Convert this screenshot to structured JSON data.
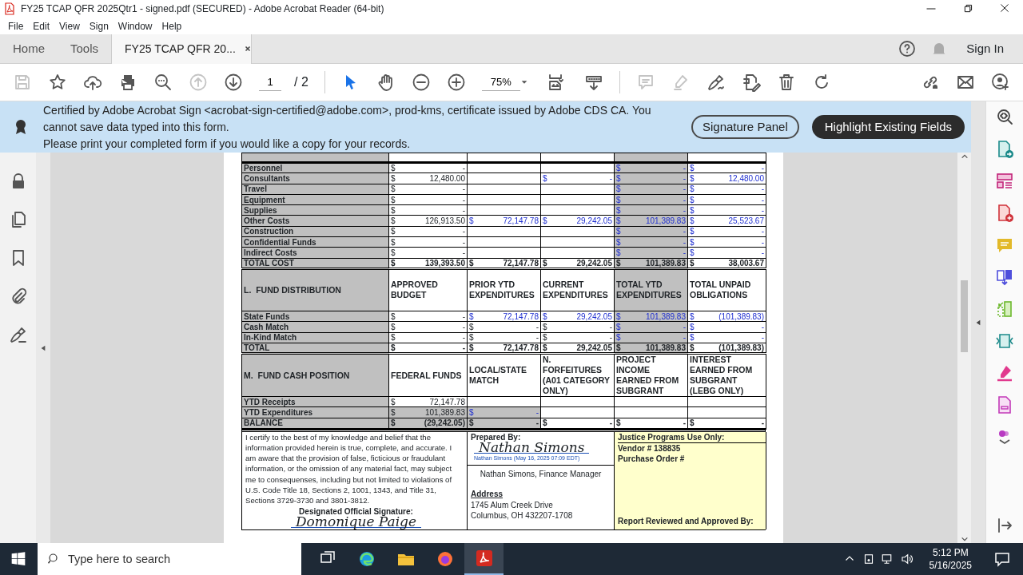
{
  "window": {
    "title": "FY25 TCAP QFR 2025Qtr1 - signed.pdf (SECURED) - Adobe Acrobat Reader (64-bit)"
  },
  "menu": [
    "File",
    "Edit",
    "View",
    "Sign",
    "Window",
    "Help"
  ],
  "tabs": [
    {
      "label": "Home",
      "selected": false
    },
    {
      "label": "Tools",
      "selected": false
    },
    {
      "label": "FY25 TCAP QFR 20...",
      "selected": true
    }
  ],
  "account": {
    "label": "Sign In"
  },
  "toolbar": {
    "tools": [
      {
        "disabled": true
      },
      {
        "disabled": false
      },
      {
        "disabled": false
      },
      {
        "disabled": false
      },
      {
        "disabled": false
      },
      {
        "disabled": true
      },
      {
        "disabled": false
      }
    ],
    "page": "1",
    "page_total": "/ 2",
    "tools_2": [
      {
        "selected": true
      },
      {
        "selected": false
      },
      {
        "selected": false
      },
      {
        "selected": false
      }
    ],
    "zoom": "75%",
    "tools_3": [
      {
        "disabled": true
      },
      {
        "disabled": true
      },
      {
        "disabled": false
      },
      {
        "disabled": false
      },
      {
        "disabled": false
      },
      {
        "disabled": false
      }
    ]
  },
  "banner": {
    "lines": [
      "Certified by Adobe Acrobat Sign <acrobat-sign-certified@adobe.com>, prod-kms, certificate issued by Adobe CDS CA.  You cannot save data typed into this form.",
      "Please print your completed form if you would like a copy for your records."
    ],
    "buttons": [
      {
        "label": "Signature Panel",
        "kind": "outline"
      },
      {
        "label": "Highlight Existing Fields",
        "kind": "dark"
      }
    ]
  },
  "document": {
    "table": {
      "rows": [
        {
          "kind": "line",
          "label": "Personnel",
          "bold": false,
          "cells": [
            {
              "kind": "amount",
              "sign": "$",
              "value": "-",
              "blue": false,
              "shaded": false
            },
            {
              "kind": "blank"
            },
            {
              "kind": "blank"
            },
            {
              "kind": "amount",
              "sign": "$",
              "value": "-",
              "blue": true,
              "shaded": true
            },
            {
              "kind": "amount",
              "sign": "$",
              "value": "-",
              "blue": true,
              "shaded": false
            }
          ]
        },
        {
          "kind": "line",
          "label": "Consultants",
          "bold": false,
          "cells": [
            {
              "kind": "amount",
              "sign": "$",
              "value": "12,480.00",
              "blue": false,
              "shaded": false
            },
            {
              "kind": "blank"
            },
            {
              "kind": "amount",
              "sign": "$",
              "value": "-",
              "blue": true,
              "shaded": false
            },
            {
              "kind": "amount",
              "sign": "$",
              "value": "-",
              "blue": true,
              "shaded": true
            },
            {
              "kind": "amount",
              "sign": "$",
              "value": "12,480.00",
              "blue": true,
              "shaded": false
            }
          ]
        },
        {
          "kind": "line",
          "label": "Travel",
          "bold": false,
          "cells": [
            {
              "kind": "amount",
              "sign": "$",
              "value": "-",
              "blue": false,
              "shaded": false
            },
            {
              "kind": "blank"
            },
            {
              "kind": "blank"
            },
            {
              "kind": "amount",
              "sign": "$",
              "value": "-",
              "blue": true,
              "shaded": true
            },
            {
              "kind": "amount",
              "sign": "$",
              "value": "-",
              "blue": true,
              "shaded": false
            }
          ]
        },
        {
          "kind": "line",
          "label": "Equipment",
          "bold": false,
          "cells": [
            {
              "kind": "amount",
              "sign": "$",
              "value": "-",
              "blue": false,
              "shaded": false
            },
            {
              "kind": "blank"
            },
            {
              "kind": "blank"
            },
            {
              "kind": "amount",
              "sign": "$",
              "value": "-",
              "blue": true,
              "shaded": true
            },
            {
              "kind": "amount",
              "sign": "$",
              "value": "-",
              "blue": true,
              "shaded": false
            }
          ]
        },
        {
          "kind": "line",
          "label": "Supplies",
          "bold": false,
          "cells": [
            {
              "kind": "amount",
              "sign": "$",
              "value": "-",
              "blue": false,
              "shaded": false
            },
            {
              "kind": "blank"
            },
            {
              "kind": "blank"
            },
            {
              "kind": "amount",
              "sign": "$",
              "value": "-",
              "blue": true,
              "shaded": true
            },
            {
              "kind": "amount",
              "sign": "$",
              "value": "-",
              "blue": true,
              "shaded": false
            }
          ]
        },
        {
          "kind": "line",
          "label": "Other Costs",
          "bold": false,
          "cells": [
            {
              "kind": "amount",
              "sign": "$",
              "value": "126,913.50",
              "blue": false,
              "shaded": false
            },
            {
              "kind": "amount",
              "sign": "$",
              "value": "72,147.78",
              "blue": true,
              "shaded": false
            },
            {
              "kind": "amount",
              "sign": "$",
              "value": "29,242.05",
              "blue": true,
              "shaded": false
            },
            {
              "kind": "amount",
              "sign": "$",
              "value": "101,389.83",
              "blue": true,
              "shaded": true
            },
            {
              "kind": "amount",
              "sign": "$",
              "value": "25,523.67",
              "blue": true,
              "shaded": false
            }
          ]
        },
        {
          "kind": "line",
          "label": "Construction",
          "bold": false,
          "cells": [
            {
              "kind": "amount",
              "sign": "$",
              "value": "-",
              "blue": false,
              "shaded": false
            },
            {
              "kind": "blank"
            },
            {
              "kind": "blank"
            },
            {
              "kind": "amount",
              "sign": "$",
              "value": "-",
              "blue": true,
              "shaded": true
            },
            {
              "kind": "amount",
              "sign": "$",
              "value": "-",
              "blue": true,
              "shaded": false
            }
          ]
        },
        {
          "kind": "line",
          "label": "Confidential Funds",
          "bold": false,
          "cells": [
            {
              "kind": "amount",
              "sign": "$",
              "value": "-",
              "blue": false,
              "shaded": false
            },
            {
              "kind": "blank"
            },
            {
              "kind": "blank"
            },
            {
              "kind": "amount",
              "sign": "$",
              "value": "-",
              "blue": true,
              "shaded": true
            },
            {
              "kind": "amount",
              "sign": "$",
              "value": "-",
              "blue": true,
              "shaded": false
            }
          ]
        },
        {
          "kind": "line",
          "label": "Indirect Costs",
          "bold": false,
          "cells": [
            {
              "kind": "amount",
              "sign": "$",
              "value": "-",
              "blue": false,
              "shaded": false
            },
            {
              "kind": "blank"
            },
            {
              "kind": "blank"
            },
            {
              "kind": "amount",
              "sign": "$",
              "value": "-",
              "blue": true,
              "shaded": true
            },
            {
              "kind": "amount",
              "sign": "$",
              "value": "-",
              "blue": true,
              "shaded": false
            }
          ]
        },
        {
          "kind": "line",
          "label": "TOTAL COST",
          "bold": true,
          "cells": [
            {
              "kind": "amount",
              "sign": "$",
              "value": "139,393.50",
              "blue": false,
              "shaded": false
            },
            {
              "kind": "amount",
              "sign": "$",
              "value": "72,147.78",
              "blue": false,
              "shaded": false
            },
            {
              "kind": "amount",
              "sign": "$",
              "value": "29,242.05",
              "blue": false,
              "shaded": false
            },
            {
              "kind": "amount",
              "sign": "$",
              "value": "101,389.83",
              "blue": false,
              "shaded": true
            },
            {
              "kind": "amount",
              "sign": "$",
              "value": "38,003.67",
              "blue": false,
              "shaded": false
            }
          ]
        },
        {
          "kind": "header",
          "label": "L.  FUND DISTRIBUTION",
          "cells": [
            {
              "label": "APPROVED BUDGET",
              "shaded": false
            },
            {
              "label": "PRIOR YTD EXPENDITURES",
              "shaded": false
            },
            {
              "label": "CURRENT EXPENDITURES",
              "shaded": false
            },
            {
              "label": "TOTAL YTD EXPENDITURES",
              "shaded": true
            },
            {
              "label": "TOTAL UNPAID OBLIGATIONS",
              "shaded": false
            }
          ]
        },
        {
          "kind": "line",
          "label": "State Funds",
          "bold": false,
          "cells": [
            {
              "kind": "amount",
              "sign": "$",
              "value": "-",
              "blue": false,
              "shaded": false
            },
            {
              "kind": "amount",
              "sign": "$",
              "value": "72,147.78",
              "blue": true,
              "shaded": false
            },
            {
              "kind": "amount",
              "sign": "$",
              "value": "29,242.05",
              "blue": true,
              "shaded": false
            },
            {
              "kind": "amount",
              "sign": "$",
              "value": "101,389.83",
              "blue": true,
              "shaded": true
            },
            {
              "kind": "amount",
              "sign": "$",
              "value": "(101,389.83)",
              "blue": true,
              "shaded": false
            }
          ]
        },
        {
          "kind": "line",
          "label": "Cash Match",
          "bold": false,
          "cells": [
            {
              "kind": "amount",
              "sign": "$",
              "value": "-",
              "blue": false,
              "shaded": false
            },
            {
              "kind": "amount",
              "sign": "$",
              "value": "-",
              "blue": false,
              "shaded": false
            },
            {
              "kind": "amount",
              "sign": "$",
              "value": "-",
              "blue": false,
              "shaded": false
            },
            {
              "kind": "amount",
              "sign": "$",
              "value": "-",
              "blue": true,
              "shaded": true
            },
            {
              "kind": "amount",
              "sign": "$",
              "value": "-",
              "blue": true,
              "shaded": false
            }
          ]
        },
        {
          "kind": "line",
          "label": "In-Kind Match",
          "bold": false,
          "cells": [
            {
              "kind": "amount",
              "sign": "$",
              "value": "-",
              "blue": false,
              "shaded": false
            },
            {
              "kind": "amount",
              "sign": "$",
              "value": "-",
              "blue": false,
              "shaded": false
            },
            {
              "kind": "amount",
              "sign": "$",
              "value": "-",
              "blue": false,
              "shaded": false
            },
            {
              "kind": "amount",
              "sign": "$",
              "value": "-",
              "blue": true,
              "shaded": true
            },
            {
              "kind": "amount",
              "sign": "$",
              "value": "-",
              "blue": true,
              "shaded": false
            }
          ]
        },
        {
          "kind": "line",
          "label": "TOTAL",
          "bold": true,
          "cells": [
            {
              "kind": "amount",
              "sign": "$",
              "value": "-",
              "blue": false,
              "shaded": false
            },
            {
              "kind": "amount",
              "sign": "$",
              "value": "72,147.78",
              "blue": false,
              "shaded": false
            },
            {
              "kind": "amount",
              "sign": "$",
              "value": "29,242.05",
              "blue": false,
              "shaded": false
            },
            {
              "kind": "amount",
              "sign": "$",
              "value": "101,389.83",
              "blue": false,
              "shaded": true
            },
            {
              "kind": "amount",
              "sign": "$",
              "value": "(101,389.83)",
              "blue": false,
              "shaded": false
            }
          ]
        },
        {
          "kind": "header",
          "label": "M.  FUND CASH POSITION",
          "cells": [
            {
              "label": "FEDERAL FUNDS",
              "shaded": false
            },
            {
              "label": "LOCAL/STATE MATCH",
              "shaded": false
            },
            {
              "label": "N.  FORFEITURES (A01 CATEGORY ONLY)",
              "shaded": false
            },
            {
              "label": "PROJECT INCOME EARNED FROM SUBGRANT",
              "shaded": false
            },
            {
              "label": "INTEREST EARNED FROM SUBGRANT (LEBG ONLY)",
              "shaded": false
            }
          ]
        },
        {
          "kind": "line",
          "label": "YTD Receipts",
          "bold": false,
          "cells": [
            {
              "kind": "amount",
              "sign": "$",
              "value": "72,147.78",
              "blue": false,
              "shaded": false
            },
            {
              "kind": "blank"
            },
            {
              "kind": "blank"
            },
            {
              "kind": "blank"
            },
            {
              "kind": "blank"
            }
          ]
        },
        {
          "kind": "line",
          "label": "YTD Expenditures",
          "bold": false,
          "cells": [
            {
              "kind": "amount",
              "sign": "$",
              "value": "101,389.83",
              "blue": false,
              "shaded": true
            },
            {
              "kind": "amount",
              "sign": "$",
              "value": "-",
              "blue": true,
              "shaded": true
            },
            {
              "kind": "blank"
            },
            {
              "kind": "blank"
            },
            {
              "kind": "blank"
            }
          ]
        },
        {
          "kind": "line",
          "label": "BALANCE",
          "bold": true,
          "cells": [
            {
              "kind": "amount",
              "sign": "$",
              "value": "(29,242.05)",
              "blue": false,
              "shaded": true
            },
            {
              "kind": "amount",
              "sign": "$",
              "value": "-",
              "blue": false,
              "shaded": true
            },
            {
              "kind": "amount",
              "sign": "$",
              "value": "-",
              "blue": false,
              "shaded": false
            },
            {
              "kind": "amount",
              "sign": "$",
              "value": "-",
              "blue": false,
              "shaded": false
            },
            {
              "kind": "amount",
              "sign": "$",
              "value": "-",
              "blue": false,
              "shaded": false
            }
          ]
        }
      ]
    },
    "certification": {
      "text": "I certify to the best of my knowledge and belief that the information provided herein is true, complete, and accurate. I am aware that the provision of false, ficticious or fraudulant information, or the omission of any material fact, may subject me to consequenses, including but not limited to violations of U.S. Code Title 18, Sections 2, 1001, 1343, and Title 31, Sections 3729-3730 and 3801-3812.",
      "signature_label": "Designated Official Signature:",
      "signature": "Domonique Paige"
    },
    "preparer": {
      "label": "Prepared By:",
      "signature": "Nathan Simons",
      "signature_caption": "Nathan Simons (May 16, 2025 07:09 EDT)",
      "name": "Nathan Simons, Finance Manager",
      "address_label": "Address",
      "address": [
        "1745 Alum Creek Drive",
        "Columbus, OH 432207-1708"
      ]
    },
    "office": {
      "title": "Justice Programs Use Only:",
      "lines": [
        "Vendor # 138835",
        "Purchase Order #"
      ],
      "footer": "Report Reviewed and Approved By:"
    }
  },
  "taskbar": {
    "search": {
      "placeholder": "Type here to search"
    },
    "apps": [
      {
        "active": false
      },
      {
        "active": false
      },
      {
        "active": false
      },
      {
        "active": false
      },
      {
        "active": true
      }
    ],
    "time": "5:12 PM",
    "date": "5/16/2025"
  }
}
